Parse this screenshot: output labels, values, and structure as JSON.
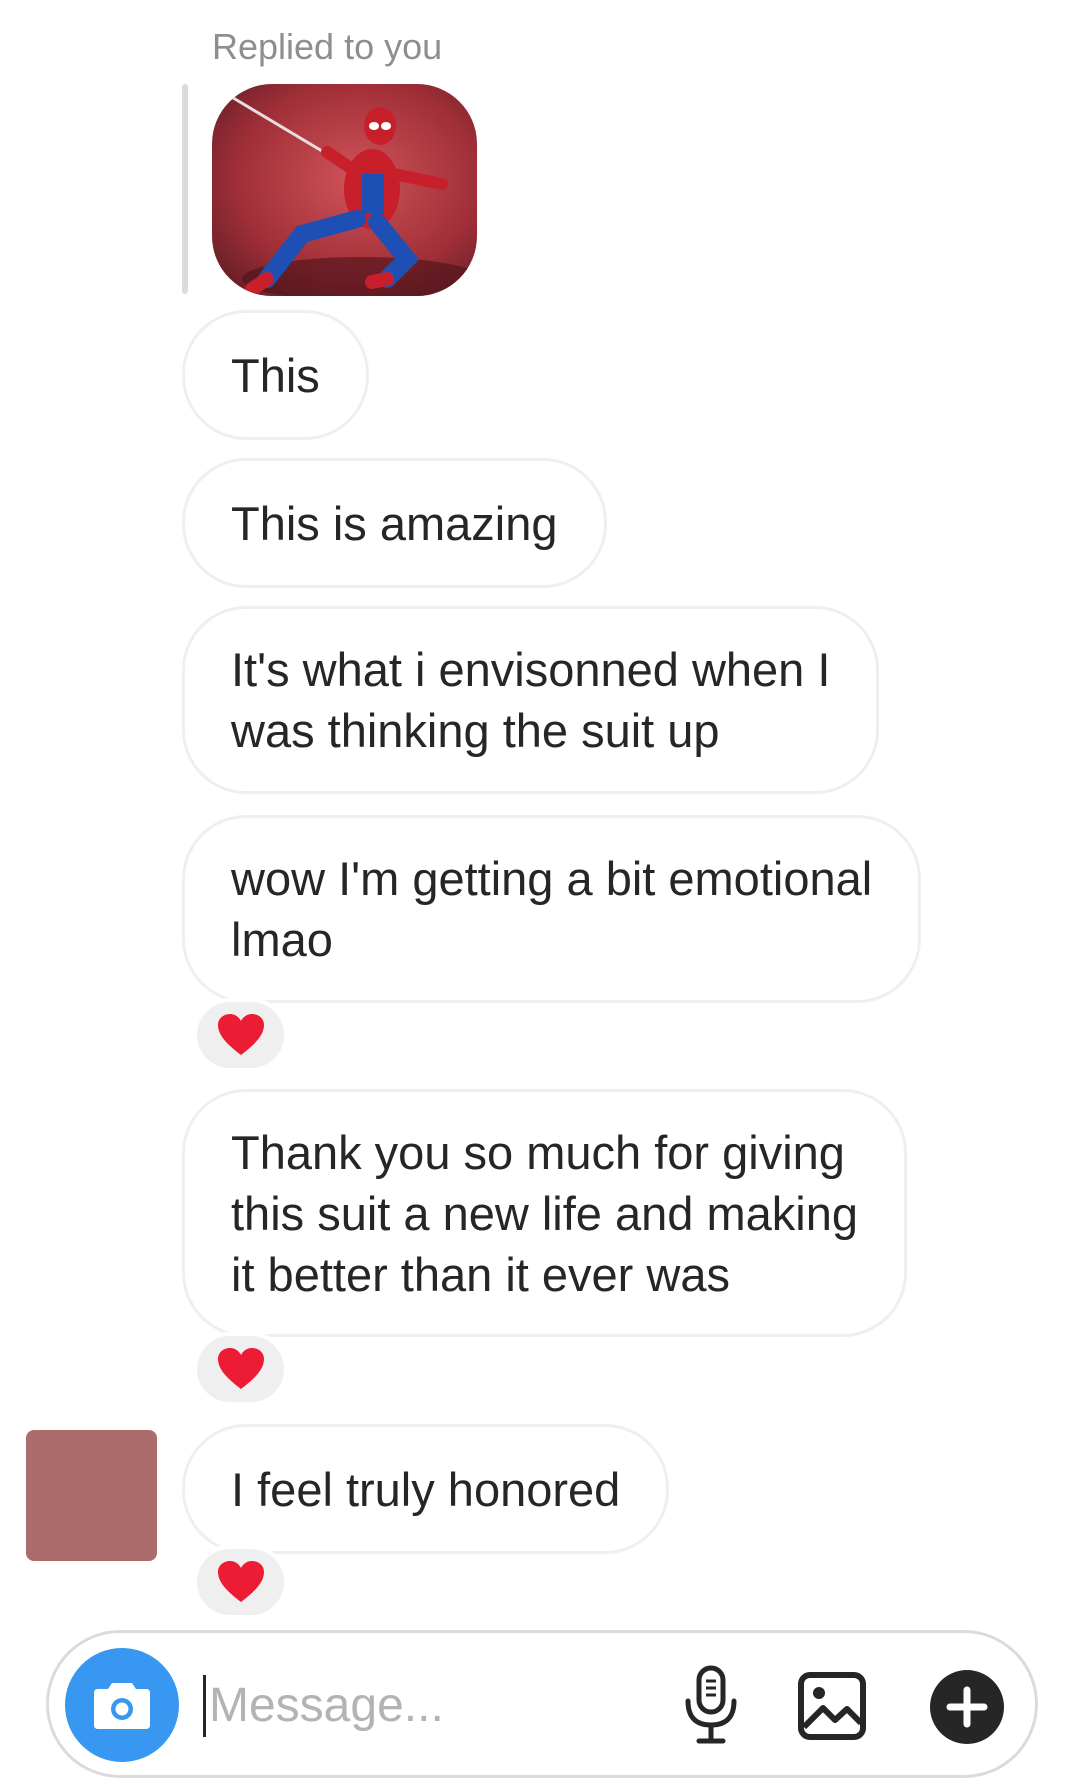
{
  "reply": {
    "label": "Replied to you",
    "image_icon": "spider-man-cosplay-photo"
  },
  "messages": [
    {
      "text": "This"
    },
    {
      "text": "This is amazing"
    },
    {
      "text": "It's what i envisonned when I\nwas thinking the suit up"
    },
    {
      "text": "wow I'm getting a bit emotional\nlmao",
      "reaction": "❤️"
    },
    {
      "text": "Thank you so much for giving\nthis suit a new life and making\nit better than it ever was",
      "reaction": "❤️"
    },
    {
      "text": "I feel truly honored",
      "reaction": "❤️"
    }
  ],
  "composer": {
    "placeholder": "Message...",
    "camera_icon": "camera-icon",
    "mic_icon": "microphone-icon",
    "gallery_icon": "gallery-icon",
    "plus_icon": "plus-icon"
  },
  "colors": {
    "accent": "#3897f0",
    "heart": "#ed1c35",
    "avatar": "#ad6c6c",
    "bubble_border": "#efefef",
    "muted_text": "#8e8e8e"
  }
}
